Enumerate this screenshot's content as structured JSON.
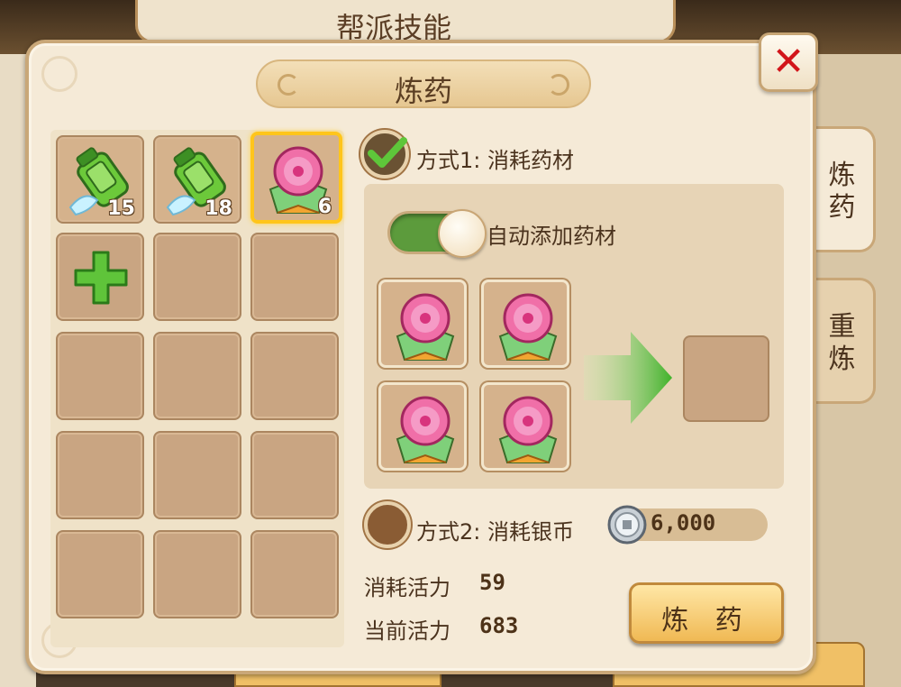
{
  "background": {
    "title": "帮派技能"
  },
  "dialog": {
    "title": "炼药",
    "close_icon": "close-x-icon"
  },
  "side_tabs": [
    {
      "label": "炼药",
      "active": true
    },
    {
      "label": "重炼",
      "active": false
    }
  ],
  "inventory": {
    "slots": [
      {
        "item": "green-bottle",
        "count": "15",
        "selected": false
      },
      {
        "item": "green-bottle",
        "count": "18",
        "selected": false
      },
      {
        "item": "pink-pill",
        "count": "6",
        "selected": true
      },
      {
        "item": "add-plus",
        "count": null,
        "selected": false
      }
    ],
    "empty_slots": 11
  },
  "mode1": {
    "label": "方式1: 消耗药材",
    "checked": true,
    "auto_add_label": "自动添加药材",
    "auto_add_on": true,
    "materials": [
      "pink-pill",
      "pink-pill",
      "pink-pill",
      "pink-pill"
    ],
    "result": null
  },
  "mode2": {
    "label": "方式2: 消耗银币",
    "checked": false,
    "cost": "6,000",
    "cost_icon": "silver-coin-icon"
  },
  "stats": {
    "consume_label": "消耗活力",
    "consume_value": "59",
    "current_label": "当前活力",
    "current_value": "683"
  },
  "action": {
    "craft_label": "炼 药"
  },
  "colors": {
    "accent_green": "#5c9b3c",
    "close_red": "#d2151a",
    "selected_gold": "#ffc51b"
  }
}
